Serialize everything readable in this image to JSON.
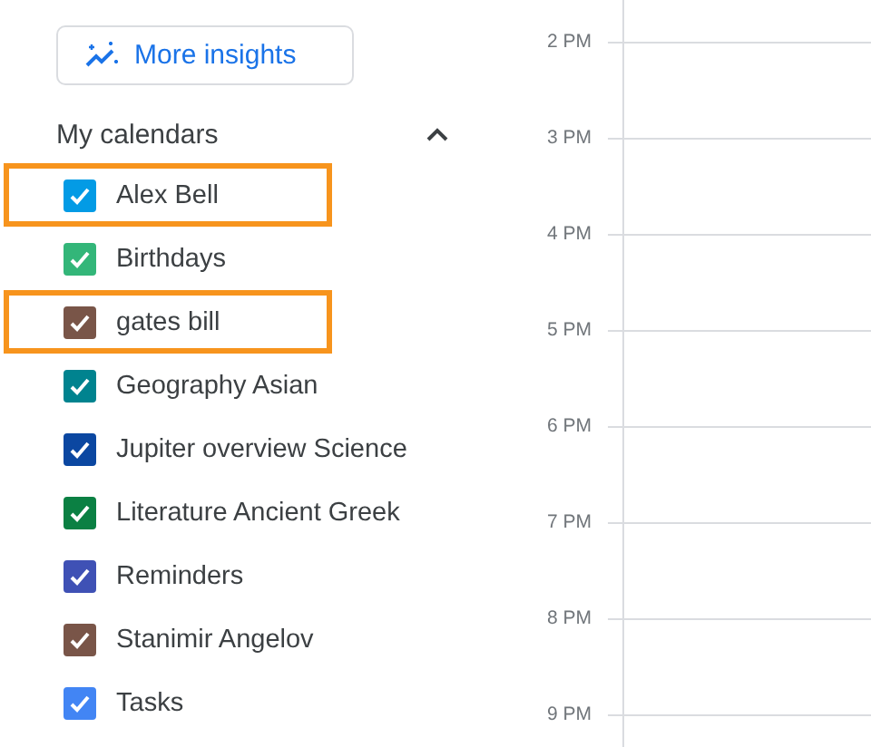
{
  "insights_button": {
    "label": "More insights"
  },
  "my_calendars": {
    "title": "My calendars",
    "expanded": true,
    "items": [
      {
        "name": "Alex Bell",
        "checked": true,
        "color": "#039be5",
        "highlighted": true
      },
      {
        "name": "Birthdays",
        "checked": true,
        "color": "#33b679",
        "highlighted": false
      },
      {
        "name": "gates bill",
        "checked": true,
        "color": "#795548",
        "highlighted": true
      },
      {
        "name": "Geography Asian",
        "checked": true,
        "color": "#00838f",
        "highlighted": false
      },
      {
        "name": "Jupiter overview Science",
        "checked": true,
        "color": "#0b47a1",
        "highlighted": false
      },
      {
        "name": "Literature Ancient Greek",
        "checked": true,
        "color": "#0b8043",
        "highlighted": false
      },
      {
        "name": "Reminders",
        "checked": true,
        "color": "#3f51b5",
        "highlighted": false
      },
      {
        "name": "Stanimir Angelov",
        "checked": true,
        "color": "#795548",
        "highlighted": false
      },
      {
        "name": "Tasks",
        "checked": true,
        "color": "#4285f4",
        "highlighted": false
      }
    ]
  },
  "time_grid": {
    "hours": [
      "2 PM",
      "3 PM",
      "4 PM",
      "5 PM",
      "6 PM",
      "7 PM",
      "8 PM",
      "9 PM"
    ]
  }
}
